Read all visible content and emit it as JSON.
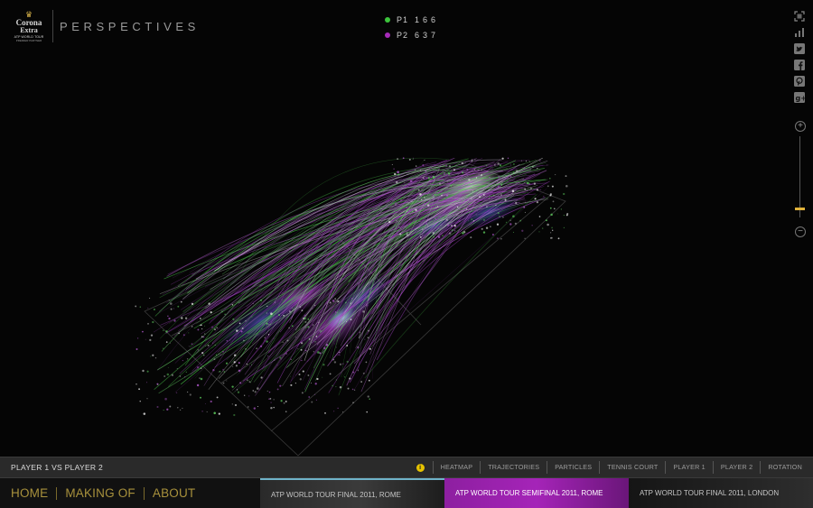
{
  "app": {
    "brand": {
      "logo_line1": "Corona",
      "logo_line2": "Extra",
      "logo_line3": "ATP WORLD TOUR",
      "logo_line4": "PREMIER PARTNER",
      "title": "PERSPECTIVES"
    }
  },
  "legend": [
    {
      "label": "P1",
      "value": "166",
      "color": "#3cc43c"
    },
    {
      "label": "P2",
      "value": "637",
      "color": "#a52bb8"
    }
  ],
  "right_rail": {
    "icons": [
      "fullscreen-icon",
      "chart-icon",
      "twitter-icon",
      "facebook-icon",
      "pinterest-icon",
      "google-plus-icon"
    ],
    "zoom": {
      "in_label": "+",
      "out_label": "−",
      "level": 0.88
    }
  },
  "control_bar": {
    "title": "PLAYER 1 VS PLAYER 2",
    "info_label": "i",
    "toggles": [
      "HEATMAP",
      "TRAJECTORIES",
      "PARTICLES",
      "TENNIS COURT",
      "PLAYER 1",
      "PLAYER 2",
      "ROTATION"
    ]
  },
  "footer": {
    "nav": [
      "HOME",
      "MAKING OF",
      "ABOUT"
    ],
    "tours": [
      "ATP WORLD TOUR FINAL 2011, ROME",
      "ATP WORLD TOUR SEMIFINAL 2011, ROME",
      "ATP WORLD TOUR FINAL 2011, LONDON"
    ]
  },
  "colors": {
    "accent_gold": "#a8913c",
    "p1_green": "#3cc43c",
    "p2_purple": "#a52bb8",
    "info_yellow": "#e6c200"
  }
}
